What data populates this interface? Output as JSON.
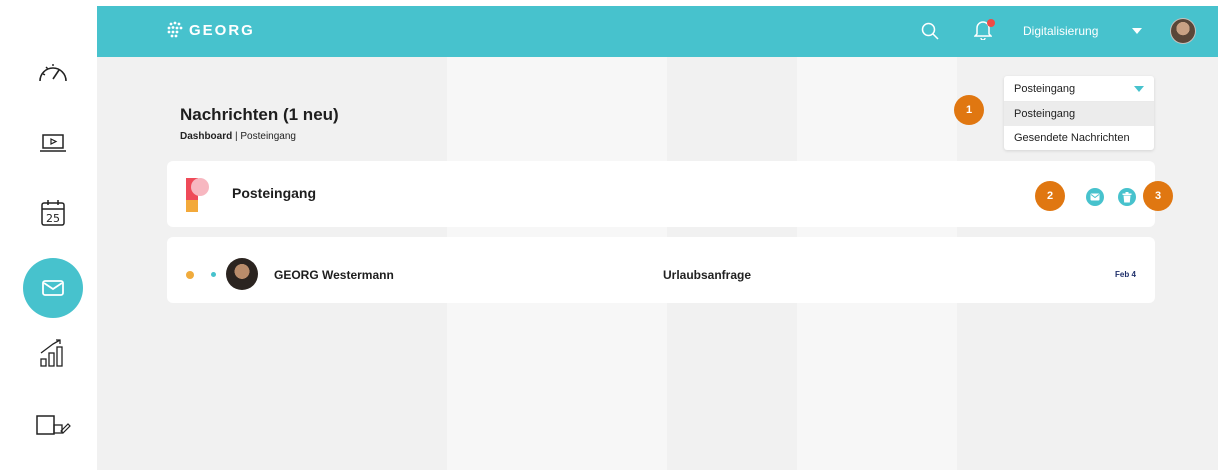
{
  "brand": {
    "name": "GEORG"
  },
  "sidebar": {
    "items": [
      {
        "icon": "speedometer-icon",
        "active": false
      },
      {
        "icon": "laptop-play-icon",
        "active": false
      },
      {
        "icon": "calendar-icon",
        "label": "25",
        "active": false
      },
      {
        "icon": "mail-icon",
        "active": true
      },
      {
        "icon": "bar-chart-icon",
        "active": false
      },
      {
        "icon": "design-tools-icon",
        "active": false
      }
    ]
  },
  "header": {
    "user_name": "Digitalisierung",
    "has_notification": true
  },
  "page": {
    "title": "Nachrichten (1 neu)",
    "breadcrumb_root": "Dashboard",
    "breadcrumb_sep": " | ",
    "breadcrumb_current": "Posteingang"
  },
  "folder_select": {
    "selected": "Posteingang",
    "options": [
      "Posteingang",
      "Gesendete Nachrichten"
    ]
  },
  "annotations": [
    "1",
    "2",
    "3"
  ],
  "inbox_card": {
    "title": "Posteingang",
    "actions": [
      "mail-icon",
      "trash-icon"
    ]
  },
  "messages": [
    {
      "sender": "GEORG Westermann",
      "subject": "Urlaubsanfrage",
      "date": "Feb 4",
      "unread": true
    }
  ],
  "colors": {
    "accent": "#47c2cd",
    "badge": "#e07711",
    "unread_dot": "#f0ab3c",
    "notification": "#f04b45"
  }
}
